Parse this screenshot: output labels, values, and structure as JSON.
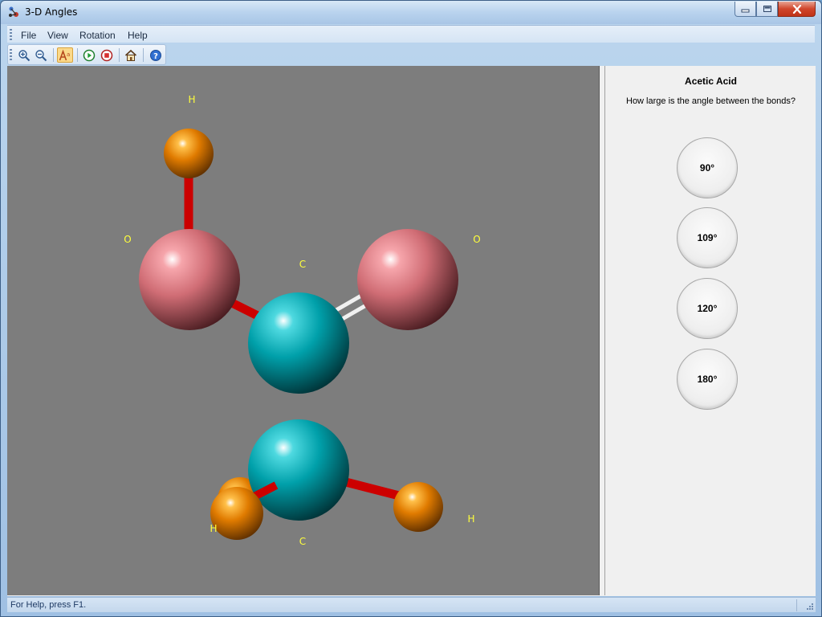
{
  "window": {
    "title": "3-D Angles"
  },
  "menu": {
    "file": "File",
    "view": "View",
    "rotation": "Rotation",
    "help": "Help"
  },
  "toolbar": {
    "buttons": [
      "zoom-in-icon",
      "zoom-out-icon",
      "font-style-icon",
      "play-icon",
      "stop-icon",
      "home-icon",
      "help-icon"
    ]
  },
  "viewport": {
    "background": "#7d7d7d",
    "label_color": "#ffff3c",
    "labels": {
      "h_top": "H",
      "o_left": "O",
      "o_right": "O",
      "c_top": "C",
      "h_bottom_left": "H",
      "c_bottom": "C",
      "h_right": "H"
    },
    "atom_colors": {
      "hydrogen": "#e07b00",
      "oxygen": "#d87078",
      "carbon": "#00a6b0"
    },
    "bond_colors": {
      "single": "#d40000",
      "double": "#ffffff"
    }
  },
  "panel": {
    "molecule": "Acetic Acid",
    "question": "How large is the angle between the bonds?",
    "answers": [
      "90°",
      "109°",
      "120°",
      "180°"
    ]
  },
  "status": {
    "text": "For Help, press F1."
  }
}
